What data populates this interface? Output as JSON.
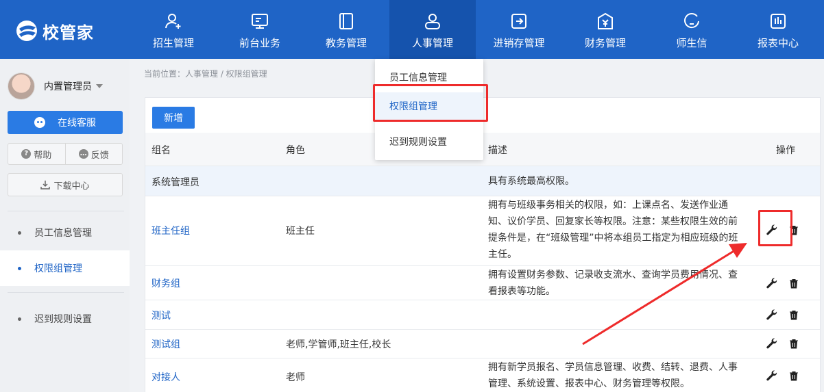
{
  "app": {
    "logo_text": "校管家"
  },
  "nav": {
    "items": [
      {
        "label": "招生管理",
        "icon": "user-add-icon"
      },
      {
        "label": "前台业务",
        "icon": "monitor-icon"
      },
      {
        "label": "教务管理",
        "icon": "book-icon"
      },
      {
        "label": "人事管理",
        "icon": "person-icon",
        "active": true
      },
      {
        "label": "进销存管理",
        "icon": "inventory-icon"
      },
      {
        "label": "财务管理",
        "icon": "finance-icon"
      },
      {
        "label": "师生信",
        "icon": "chat-icon"
      },
      {
        "label": "报表中心",
        "icon": "report-icon"
      }
    ]
  },
  "dropdown": {
    "items": [
      "员工信息管理",
      "权限组管理",
      "迟到规则设置"
    ],
    "active_index": 1
  },
  "sidebar": {
    "user_name": "内置管理员",
    "service_label": "在线客服",
    "help_label": "帮助",
    "feedback_label": "反馈",
    "download_label": "下载中心",
    "menu": [
      "员工信息管理",
      "权限组管理",
      "迟到规则设置"
    ],
    "active_index": 1
  },
  "breadcrumb": "当前位置：人事管理 / 权限组管理",
  "toolbar": {
    "add_label": "新增"
  },
  "table": {
    "headers": {
      "name": "组名",
      "role": "角色",
      "desc": "描述",
      "ops": "操作"
    },
    "rows": [
      {
        "name": "系统管理员",
        "role": "",
        "desc": "具有系统最高权限。"
      },
      {
        "name": "班主任组",
        "role": "班主任",
        "desc": "拥有与班级事务相关的权限，如：上课点名、发送作业通知、议价学员、回复家长等权限。注意：某些权限生效的前提条件是，在“班级管理”中将本组员工指定为相应班级的班主任。"
      },
      {
        "name": "财务组",
        "role": "",
        "desc": "拥有设置财务参数、记录收支流水、查询学员费用情况、查看报表等功能。"
      },
      {
        "name": "测试",
        "role": "",
        "desc": ""
      },
      {
        "name": "测试组",
        "role": "老师,学管师,班主任,校长",
        "desc": ""
      },
      {
        "name": "对接人",
        "role": "老师",
        "desc": "拥有新学员报名、学员信息管理、收费、结转、退费、人事管理、系统设置、报表中心、财务管理等权限。"
      }
    ]
  },
  "colors": {
    "primary": "#1f64c6",
    "button": "#2a7be4",
    "annotation": "#ee2b2b"
  }
}
